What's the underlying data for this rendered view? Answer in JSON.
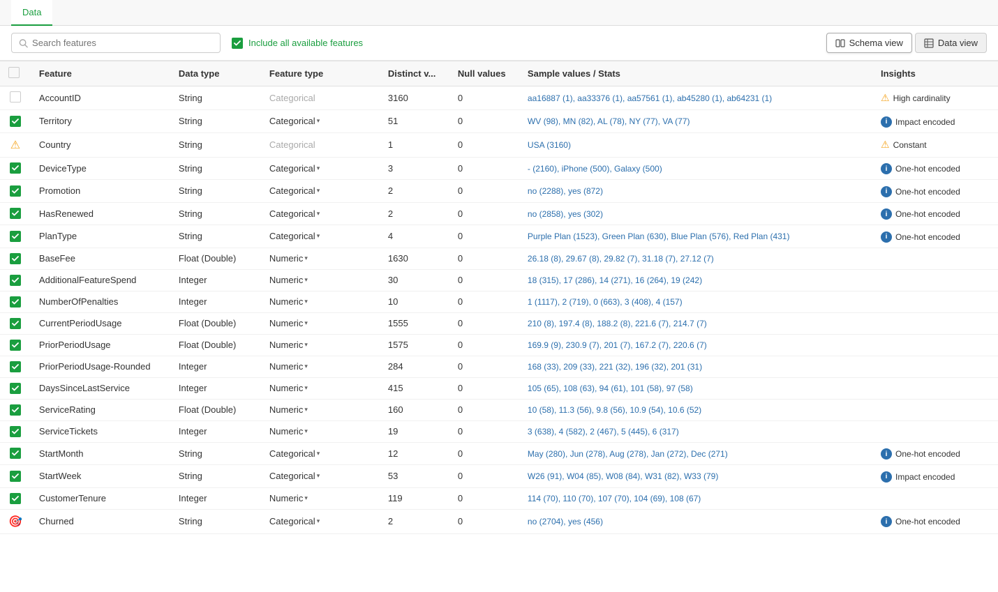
{
  "tabs": [
    {
      "label": "Data",
      "active": true
    }
  ],
  "toolbar": {
    "search_placeholder": "Search features",
    "include_all_label": "Include all available features",
    "schema_view_label": "Schema view",
    "data_view_label": "Data view"
  },
  "table": {
    "headers": [
      "",
      "Feature",
      "Data type",
      "Feature type",
      "Distinct v...",
      "Null values",
      "Sample values / Stats",
      "Insights"
    ],
    "rows": [
      {
        "checkbox": "unchecked",
        "feature": "AccountID",
        "data_type": "String",
        "feature_type": "Categorical",
        "feature_type_disabled": true,
        "distinct": "3160",
        "null": "0",
        "sample": "aa16887 (1), aa33376 (1), aa57561 (1), ab45280 (1), ab64231 (1)",
        "insight_type": "warning",
        "insight_text": "High cardinality",
        "has_dropdown": false
      },
      {
        "checkbox": "checked",
        "feature": "Territory",
        "data_type": "String",
        "feature_type": "Categorical",
        "feature_type_disabled": false,
        "distinct": "51",
        "null": "0",
        "sample": "WV (98), MN (82), AL (78), NY (77), VA (77)",
        "insight_type": "info",
        "insight_text": "Impact encoded",
        "has_dropdown": true
      },
      {
        "checkbox": "warning",
        "feature": "Country",
        "data_type": "String",
        "feature_type": "Categorical",
        "feature_type_disabled": true,
        "distinct": "1",
        "null": "0",
        "sample": "USA (3160)",
        "insight_type": "warning",
        "insight_text": "Constant",
        "has_dropdown": false
      },
      {
        "checkbox": "checked",
        "feature": "DeviceType",
        "data_type": "String",
        "feature_type": "Categorical",
        "feature_type_disabled": false,
        "distinct": "3",
        "null": "0",
        "sample": "- (2160), iPhone (500), Galaxy (500)",
        "insight_type": "info",
        "insight_text": "One-hot encoded",
        "has_dropdown": true
      },
      {
        "checkbox": "checked",
        "feature": "Promotion",
        "data_type": "String",
        "feature_type": "Categorical",
        "feature_type_disabled": false,
        "distinct": "2",
        "null": "0",
        "sample": "no (2288), yes (872)",
        "insight_type": "info",
        "insight_text": "One-hot encoded",
        "has_dropdown": true
      },
      {
        "checkbox": "checked",
        "feature": "HasRenewed",
        "data_type": "String",
        "feature_type": "Categorical",
        "feature_type_disabled": false,
        "distinct": "2",
        "null": "0",
        "sample": "no (2858), yes (302)",
        "insight_type": "info",
        "insight_text": "One-hot encoded",
        "has_dropdown": true
      },
      {
        "checkbox": "checked",
        "feature": "PlanType",
        "data_type": "String",
        "feature_type": "Categorical",
        "feature_type_disabled": false,
        "distinct": "4",
        "null": "0",
        "sample": "Purple Plan (1523), Green Plan (630), Blue Plan (576), Red Plan (431)",
        "insight_type": "info",
        "insight_text": "One-hot encoded",
        "has_dropdown": true
      },
      {
        "checkbox": "checked",
        "feature": "BaseFee",
        "data_type": "Float (Double)",
        "feature_type": "Numeric",
        "feature_type_disabled": false,
        "distinct": "1630",
        "null": "0",
        "sample": "26.18 (8), 29.67 (8), 29.82 (7), 31.18 (7), 27.12 (7)",
        "insight_type": "none",
        "insight_text": "",
        "has_dropdown": true
      },
      {
        "checkbox": "checked",
        "feature": "AdditionalFeatureSpend",
        "data_type": "Integer",
        "feature_type": "Numeric",
        "feature_type_disabled": false,
        "distinct": "30",
        "null": "0",
        "sample": "18 (315), 17 (286), 14 (271), 16 (264), 19 (242)",
        "insight_type": "none",
        "insight_text": "",
        "has_dropdown": true
      },
      {
        "checkbox": "checked",
        "feature": "NumberOfPenalties",
        "data_type": "Integer",
        "feature_type": "Numeric",
        "feature_type_disabled": false,
        "distinct": "10",
        "null": "0",
        "sample": "1 (1117), 2 (719), 0 (663), 3 (408), 4 (157)",
        "insight_type": "none",
        "insight_text": "",
        "has_dropdown": true
      },
      {
        "checkbox": "checked",
        "feature": "CurrentPeriodUsage",
        "data_type": "Float (Double)",
        "feature_type": "Numeric",
        "feature_type_disabled": false,
        "distinct": "1555",
        "null": "0",
        "sample": "210 (8), 197.4 (8), 188.2 (8), 221.6 (7), 214.7 (7)",
        "insight_type": "none",
        "insight_text": "",
        "has_dropdown": true
      },
      {
        "checkbox": "checked",
        "feature": "PriorPeriodUsage",
        "data_type": "Float (Double)",
        "feature_type": "Numeric",
        "feature_type_disabled": false,
        "distinct": "1575",
        "null": "0",
        "sample": "169.9 (9), 230.9 (7), 201 (7), 167.2 (7), 220.6 (7)",
        "insight_type": "none",
        "insight_text": "",
        "has_dropdown": true
      },
      {
        "checkbox": "checked",
        "feature": "PriorPeriodUsage-Rounded",
        "data_type": "Integer",
        "feature_type": "Numeric",
        "feature_type_disabled": false,
        "distinct": "284",
        "null": "0",
        "sample": "168 (33), 209 (33), 221 (32), 196 (32), 201 (31)",
        "insight_type": "none",
        "insight_text": "",
        "has_dropdown": true
      },
      {
        "checkbox": "checked",
        "feature": "DaysSinceLastService",
        "data_type": "Integer",
        "feature_type": "Numeric",
        "feature_type_disabled": false,
        "distinct": "415",
        "null": "0",
        "sample": "105 (65), 108 (63), 94 (61), 101 (58), 97 (58)",
        "insight_type": "none",
        "insight_text": "",
        "has_dropdown": true
      },
      {
        "checkbox": "checked",
        "feature": "ServiceRating",
        "data_type": "Float (Double)",
        "feature_type": "Numeric",
        "feature_type_disabled": false,
        "distinct": "160",
        "null": "0",
        "sample": "10 (58), 11.3 (56), 9.8 (56), 10.9 (54), 10.6 (52)",
        "insight_type": "none",
        "insight_text": "",
        "has_dropdown": true
      },
      {
        "checkbox": "checked",
        "feature": "ServiceTickets",
        "data_type": "Integer",
        "feature_type": "Numeric",
        "feature_type_disabled": false,
        "distinct": "19",
        "null": "0",
        "sample": "3 (638), 4 (582), 2 (467), 5 (445), 6 (317)",
        "insight_type": "none",
        "insight_text": "",
        "has_dropdown": true
      },
      {
        "checkbox": "checked",
        "feature": "StartMonth",
        "data_type": "String",
        "feature_type": "Categorical",
        "feature_type_disabled": false,
        "distinct": "12",
        "null": "0",
        "sample": "May (280), Jun (278), Aug (278), Jan (272), Dec (271)",
        "insight_type": "info",
        "insight_text": "One-hot encoded",
        "has_dropdown": true
      },
      {
        "checkbox": "checked",
        "feature": "StartWeek",
        "data_type": "String",
        "feature_type": "Categorical",
        "feature_type_disabled": false,
        "distinct": "53",
        "null": "0",
        "sample": "W26 (91), W04 (85), W08 (84), W31 (82), W33 (79)",
        "insight_type": "info",
        "insight_text": "Impact encoded",
        "has_dropdown": true
      },
      {
        "checkbox": "checked",
        "feature": "CustomerTenure",
        "data_type": "Integer",
        "feature_type": "Numeric",
        "feature_type_disabled": false,
        "distinct": "119",
        "null": "0",
        "sample": "114 (70), 110 (70), 107 (70), 104 (69), 108 (67)",
        "insight_type": "none",
        "insight_text": "",
        "has_dropdown": true
      },
      {
        "checkbox": "target",
        "feature": "Churned",
        "data_type": "String",
        "feature_type": "Categorical",
        "feature_type_disabled": false,
        "distinct": "2",
        "null": "0",
        "sample": "no (2704), yes (456)",
        "insight_type": "info",
        "insight_text": "One-hot encoded",
        "has_dropdown": true
      }
    ]
  }
}
